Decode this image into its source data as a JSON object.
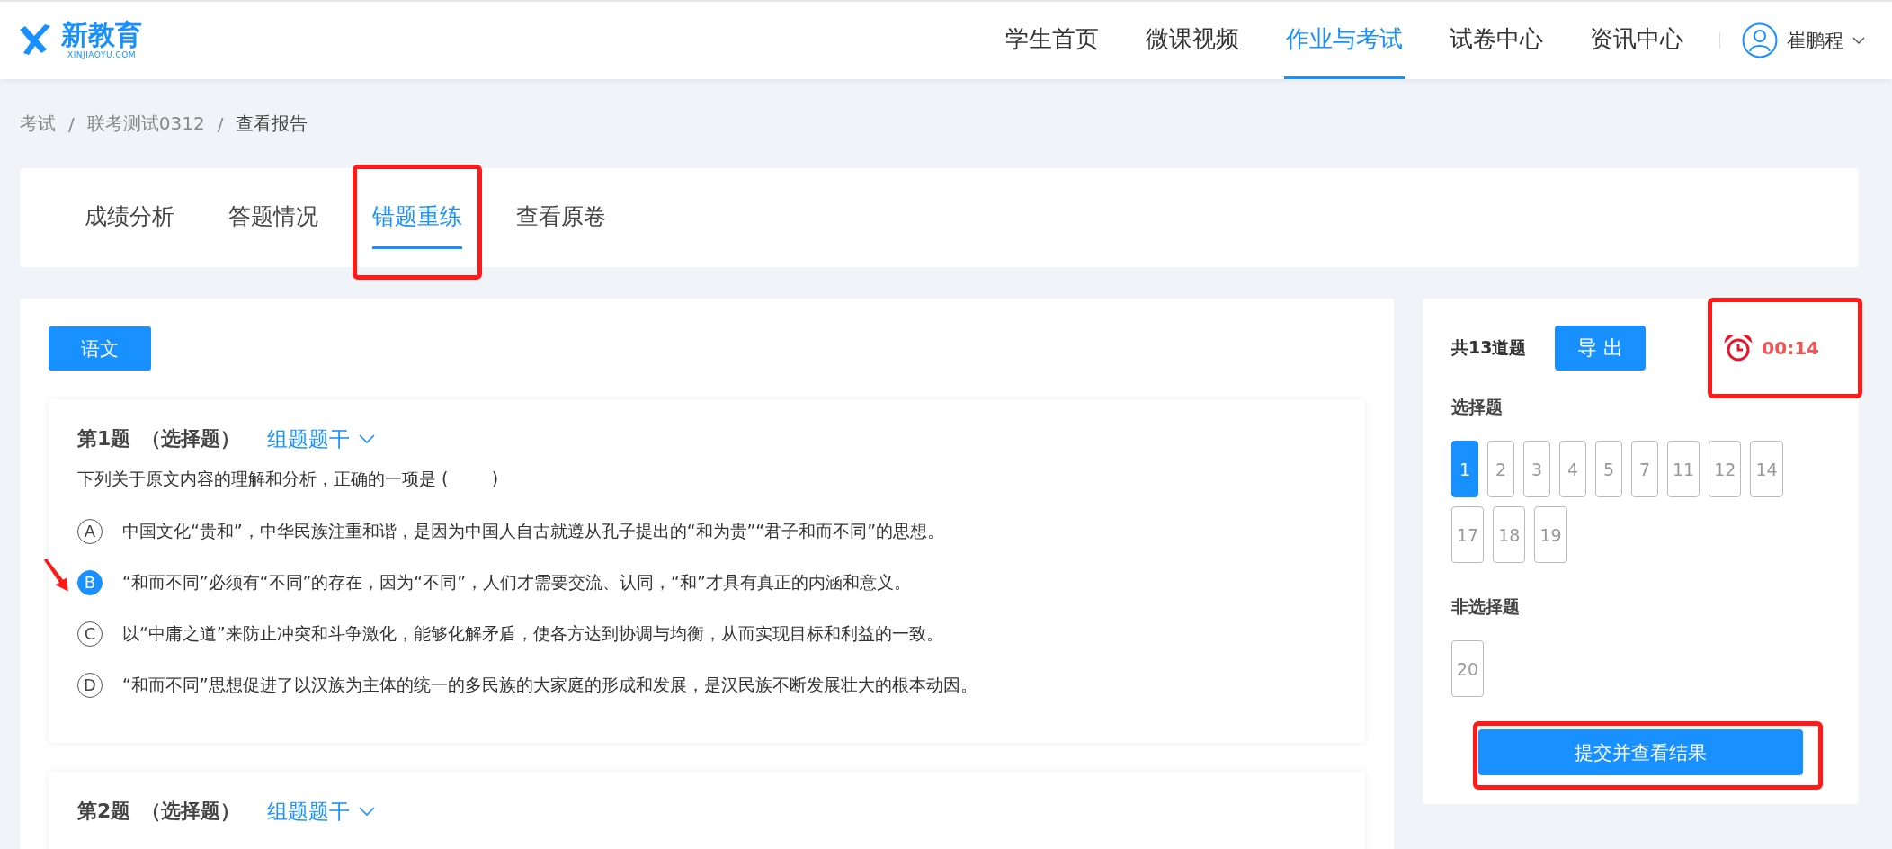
{
  "header": {
    "logo": {
      "name": "新教育",
      "sub": "XINJIAOYU.COM"
    },
    "nav": [
      {
        "label": "学生首页",
        "selected": false
      },
      {
        "label": "微课视频",
        "selected": false
      },
      {
        "label": "作业与考试",
        "selected": true
      },
      {
        "label": "试卷中心",
        "selected": false
      },
      {
        "label": "资讯中心",
        "selected": false
      }
    ],
    "user": {
      "name": "崔鹏程"
    }
  },
  "breadcrumb": [
    "考试",
    "/",
    "联考测试0312",
    "/",
    "查看报告"
  ],
  "tabs": [
    {
      "label": "成绩分析",
      "selected": false,
      "highlighted": false
    },
    {
      "label": "答题情况",
      "selected": false,
      "highlighted": false
    },
    {
      "label": "错题重练",
      "selected": true,
      "highlighted": true
    },
    {
      "label": "查看原卷",
      "selected": false,
      "highlighted": false
    }
  ],
  "subject": "语文",
  "questions": [
    {
      "number": "第1题",
      "type": "（选择题）",
      "group_link": "组题题干",
      "stem": "下列关于原文内容的理解和分析，正确的一项是 (        )",
      "options": [
        {
          "letter": "A",
          "text": "中国文化“贵和”，中华民族注重和谐，是因为中国人自古就遵从孔子提出的“和为贵”“君子和而不同”的思想。",
          "selected": false,
          "arrow": false
        },
        {
          "letter": "B",
          "text": "“和而不同”必须有“不同”的存在，因为“不同”，人们才需要交流、认同，“和”才具有真正的内涵和意义。",
          "selected": true,
          "arrow": true
        },
        {
          "letter": "C",
          "text": "以“中庸之道”来防止冲突和斗争激化，能够化解矛盾，使各方达到协调与均衡，从而实现目标和利益的一致。",
          "selected": false,
          "arrow": false
        },
        {
          "letter": "D",
          "text": "“和而不同”思想促进了以汉族为主体的统一的多民族的大家庭的形成和发展，是汉民族不断发展壮大的根本动因。",
          "selected": false,
          "arrow": false
        }
      ]
    },
    {
      "number": "第2题",
      "type": "（选择题）",
      "group_link": "组题题干"
    }
  ],
  "panel": {
    "total": "共13道题",
    "export_button": "导 出",
    "timer": {
      "time": "00:14",
      "highlighted": true
    },
    "sections": [
      {
        "title": "选择题",
        "numbers": [
          {
            "label": "1",
            "selected": true
          },
          {
            "label": "2",
            "selected": false
          },
          {
            "label": "3",
            "selected": false
          },
          {
            "label": "4",
            "selected": false
          },
          {
            "label": "5",
            "selected": false
          },
          {
            "label": "7",
            "selected": false
          },
          {
            "label": "11",
            "selected": false
          },
          {
            "label": "12",
            "selected": false
          },
          {
            "label": "14",
            "selected": false
          },
          {
            "label": "17",
            "selected": false
          },
          {
            "label": "18",
            "selected": false
          },
          {
            "label": "19",
            "selected": false
          }
        ]
      },
      {
        "title": "非选择题",
        "numbers": [
          {
            "label": "20",
            "selected": false
          }
        ]
      }
    ],
    "submit": {
      "label": "提交并查看结果",
      "highlighted": true
    }
  }
}
